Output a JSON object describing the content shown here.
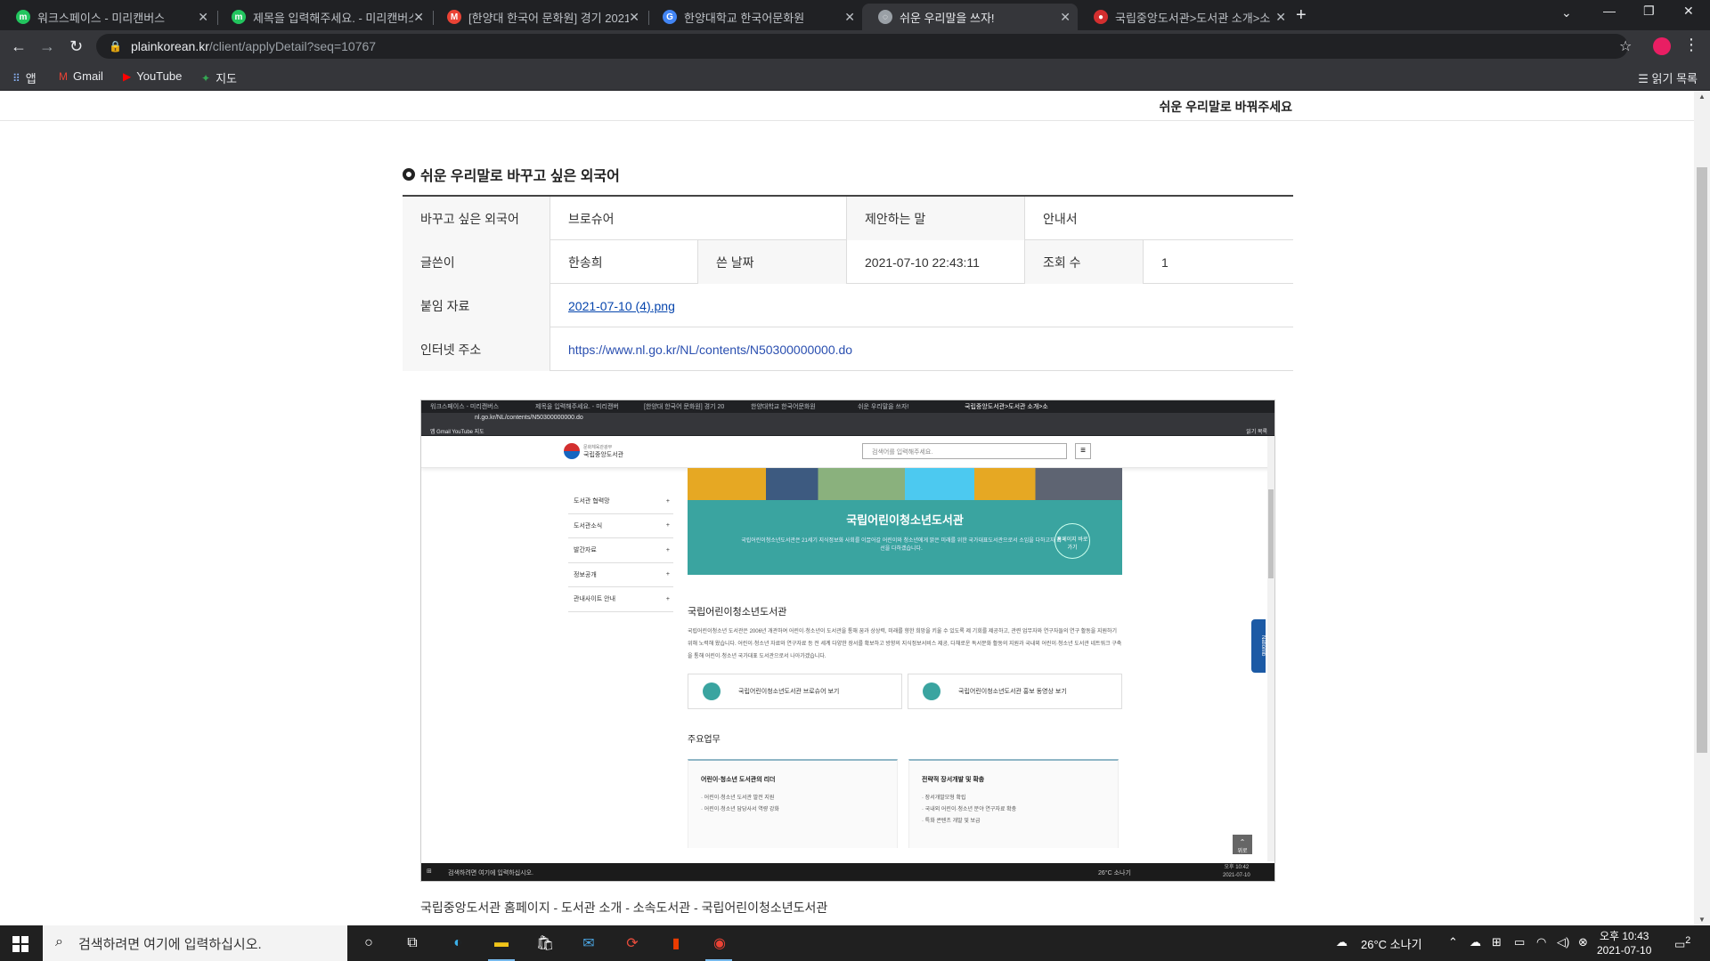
{
  "browser": {
    "tabs": [
      {
        "title": "워크스페이스 - 미리캔버스",
        "icon": "miricanvas-icon",
        "color": "#22c55e"
      },
      {
        "title": "제목을 입력해주세요. - 미리캔버스",
        "icon": "miricanvas-icon",
        "color": "#22c55e"
      },
      {
        "title": "[한양대 한국어 문화원] 경기 2021",
        "icon": "gmail-icon",
        "color": "#ea4335"
      },
      {
        "title": "한양대학교 한국어문화원",
        "icon": "google-docs-icon",
        "color": "#4285f4"
      },
      {
        "title": "쉬운 우리말을 쓰자!",
        "icon": "globe-icon",
        "color": "#9aa0a6"
      },
      {
        "title": "국립중앙도서관>도서관 소개>소",
        "icon": "nl-icon",
        "color": "#d32f2f"
      }
    ],
    "url_host": "plainkorean.kr",
    "url_path": "/client/applyDetail?seq=10767",
    "bookmarks": [
      {
        "label": "앱",
        "icon": "apps-icon"
      },
      {
        "label": "Gmail",
        "icon": "gmail-icon"
      },
      {
        "label": "YouTube",
        "icon": "youtube-icon"
      },
      {
        "label": "지도",
        "icon": "maps-icon"
      }
    ],
    "reading_list": "읽기 목록"
  },
  "page": {
    "topbar_title": "쉬운 우리말로 바꿔주세요",
    "section_title": "쉬운 우리말로 바꾸고 싶은 외국어",
    "table": {
      "foreign_word_label": "바꾸고 싶은 외국어",
      "foreign_word_value": "브로슈어",
      "suggest_label": "제안하는 말",
      "suggest_value": "안내서",
      "author_label": "글쓴이",
      "author_value": "한송희",
      "date_label": "쓴 날짜",
      "date_value": "2021-07-10 22:43:11",
      "views_label": "조회 수",
      "views_value": "1",
      "attachment_label": "붙임 자료",
      "attachment_value": "2021-07-10 (4).png",
      "url_label": "인터넷 주소",
      "url_value": "https://www.nl.go.kr/NL/contents/N50300000000.do"
    },
    "caption": "국립중앙도서관 홈페이지 - 도서관 소개 - 소속도서관 - 국립어린이청소년도서관"
  },
  "screenshot": {
    "tabs": [
      "워크스페이스 - 미리캔버스",
      "제목을 입력해주세요. - 미리캔버",
      "[한양대 한국어 문화원] 경기 20",
      "한양대학교 한국어문화원",
      "쉬운 우리말을 쓰자!",
      "국립중앙도서관>도서관 소개>소"
    ],
    "url": "nl.go.kr/NL/contents/N50300000000.do",
    "bookmarks": "앱   Gmail   YouTube   지도",
    "reading_list": "읽기 목록",
    "logo_line1": "문화체육관광부",
    "logo_line2": "국립중앙도서관",
    "search_placeholder": "검색어를 입력해주세요.",
    "side_menu": [
      "도서관 협력망",
      "도서관소식",
      "발간자료",
      "정보공개",
      "관내사이트 안내"
    ],
    "banner_title": "국립어린이청소년도서관",
    "banner_sub": "국립어린이청소년도서관은 21세기 지식정보화 사회를 이끌어갈 어린이와 청소년에게 밝은 미래를 위한 국가대표도서관으로서 소임을 다하고자 최선을 다하겠습니다.",
    "banner_btn": "홈페이지 바로가기",
    "h2": "국립어린이청소년도서관",
    "paragraph": "국립어린이청소년 도서관은 2006년 개관하여 어린이·청소년이 도서관을 통해 꿈과 상상력, 미래를 향한 희망을 키울 수 있도록 제 기회를 제공하고, 관련 업무자와 연구자들의 연구 활동을 지원하기 위해 노력해 왔습니다. 어린이·청소년 자료와 연구자료 등 전 세계 다양한 장서를 확보하고 방향의 지식정보서비스 제공, 다채로운 독서문화 활동의 지원과 국내외 어린이·청소년 도서관 네트워크 구축을 통해 어린이·청소년 국가대표 도서관으로서 나아가겠습니다.",
    "card1": "국립어린이청소년도서관 브로슈어 보기",
    "card2": "국립어린이청소년도서관 홍보 동영상 보기",
    "h3": "주요업무",
    "box1_title": "어린이·청소년 도서관의 리더",
    "box1_items": [
      "어린이·청소년 도서관 발전 지원",
      "어린이·청소년 담당사서 역량 강화"
    ],
    "box2_title": "전략적 장서개발 및 확충",
    "box2_items": [
      "장서개발모형 확립",
      "국내외 어린이·청소년 분야 연구자료 확충",
      "특화 콘텐츠 개발 및 보급"
    ],
    "side_tab": "Nationlib",
    "top_btn": "위로",
    "taskbar_search": "검색하려면 여기에 입력하십시오.",
    "taskbar_weather": "26°C 소나기",
    "taskbar_time": "오후 10:42",
    "taskbar_date": "2021-07-10"
  },
  "taskbar": {
    "search_placeholder": "검색하려면 여기에 입력하십시오.",
    "weather": "26°C 소나기",
    "time": "오후 10:43",
    "date": "2021-07-10",
    "notifications": "2"
  }
}
